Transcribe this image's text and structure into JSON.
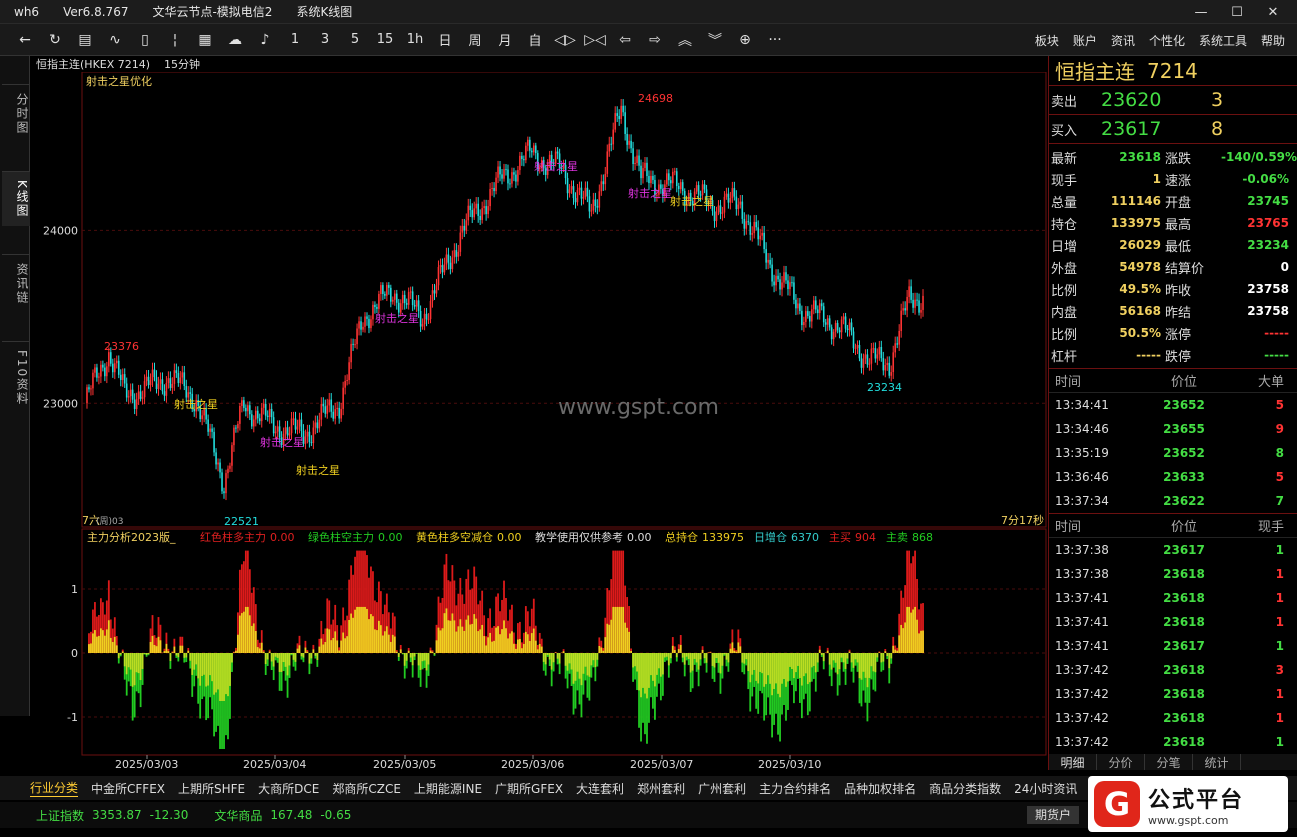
{
  "titlebar": {
    "app": "wh6",
    "version": "Ver6.8.767",
    "node": "文华云节点-模拟电信2",
    "window": "系统K线图",
    "min": "—",
    "max": "☐",
    "close": "✕"
  },
  "toolbar": {
    "period_buttons": [
      "1",
      "3",
      "5",
      "15",
      "1h",
      "日",
      "周",
      "月",
      "自"
    ],
    "right_menu": [
      "板块",
      "账户",
      "资讯",
      "个性化",
      "系统工具",
      "帮助"
    ]
  },
  "left_tabs": [
    "分时图",
    "K线图",
    "资讯链",
    "F10资料"
  ],
  "chart": {
    "instrument": "恒指主连(HKEX 7214)",
    "period": "15分钟",
    "indicator_name": "射击之星优化",
    "y_labels": [
      "24000",
      "23000"
    ],
    "high_label": "24698",
    "low_label1": "22521",
    "low_label2": "23234",
    "left_label": "23376",
    "pattern_label": "射击之星",
    "watermark": "www.gspt.com",
    "left_corner": "7六",
    "left_corner_sub": "(周)03",
    "countdown": "7分17秒",
    "sub_title": "主力分析2023版_",
    "sub_items": [
      {
        "label": "红色柱多主力",
        "value": "0.00",
        "color": "#e02020"
      },
      {
        "label": "绿色柱空主力",
        "value": "0.00",
        "color": "#22cc22"
      },
      {
        "label": "黄色柱多空减仓",
        "value": "0.00",
        "color": "#f0d020"
      },
      {
        "label": "教学使用仅供参考",
        "value": "0.00",
        "color": "#dddddd"
      },
      {
        "label": "总持仓",
        "value": "133975",
        "color": "#f0d020"
      },
      {
        "label": "日增仓",
        "value": "6370",
        "color": "#33cccc"
      },
      {
        "label": "主买",
        "value": "904",
        "color": "#e02020"
      },
      {
        "label": "主卖",
        "value": "868",
        "color": "#22cc22"
      }
    ],
    "sub_y_labels": [
      "1",
      "0",
      "-1"
    ],
    "dates": [
      "2025/03/03",
      "2025/03/04",
      "2025/03/05",
      "2025/03/06",
      "2025/03/07",
      "2025/03/10"
    ]
  },
  "quote": {
    "name": "恒指主连",
    "code": "7214",
    "sell_label": "卖出",
    "sell_price": "23620",
    "sell_vol": "3",
    "buy_label": "买入",
    "buy_price": "23617",
    "buy_vol": "8",
    "stats": [
      {
        "l1": "最新",
        "v1": "23618",
        "c1": "#44dd44",
        "l2": "涨跌",
        "v2": "-140/0.59%",
        "c2": "#44dd44"
      },
      {
        "l1": "现手",
        "v1": "1",
        "c1": "#f0d060",
        "l2": "速涨",
        "v2": "-0.06%",
        "c2": "#44dd44"
      },
      {
        "l1": "总量",
        "v1": "111146",
        "c1": "#f0d060",
        "l2": "开盘",
        "v2": "23745",
        "c2": "#44dd44"
      },
      {
        "l1": "持仓",
        "v1": "133975",
        "c1": "#f0d060",
        "l2": "最高",
        "v2": "23765",
        "c2": "#ff3333"
      },
      {
        "l1": "日增",
        "v1": "26029",
        "c1": "#f0d060",
        "l2": "最低",
        "v2": "23234",
        "c2": "#44dd44"
      },
      {
        "l1": "外盘",
        "v1": "54978",
        "c1": "#f0d060",
        "l2": "结算价",
        "v2": "0",
        "c2": "#ffffff"
      },
      {
        "l1": "比例",
        "v1": "49.5%",
        "c1": "#f0d060",
        "l2": "昨收",
        "v2": "23758",
        "c2": "#ffffff"
      },
      {
        "l1": "内盘",
        "v1": "56168",
        "c1": "#f0d060",
        "l2": "昨结",
        "v2": "23758",
        "c2": "#ffffff"
      },
      {
        "l1": "比例",
        "v1": "50.5%",
        "c1": "#f0d060",
        "l2": "涨停",
        "v2": "-----",
        "c2": "#ff3333"
      },
      {
        "l1": "杠杆",
        "v1": "-----",
        "c1": "#f0d060",
        "l2": "跌停",
        "v2": "-----",
        "c2": "#44dd44"
      }
    ],
    "big_head": [
      "时间",
      "价位",
      "大单"
    ],
    "big_orders": [
      {
        "t": "13:34:41",
        "p": "23652",
        "v": "5",
        "vc": "#ff3333"
      },
      {
        "t": "13:34:46",
        "p": "23655",
        "v": "9",
        "vc": "#ff3333"
      },
      {
        "t": "13:35:19",
        "p": "23652",
        "v": "8",
        "vc": "#44dd44"
      },
      {
        "t": "13:36:46",
        "p": "23633",
        "v": "5",
        "vc": "#ff3333"
      },
      {
        "t": "13:37:34",
        "p": "23622",
        "v": "7",
        "vc": "#44dd44"
      }
    ],
    "tick_head": [
      "时间",
      "价位",
      "现手"
    ],
    "ticks": [
      {
        "t": "13:37:38",
        "p": "23617",
        "v": "1",
        "vc": "#44dd44"
      },
      {
        "t": "13:37:38",
        "p": "23618",
        "v": "1",
        "vc": "#ff3333"
      },
      {
        "t": "13:37:41",
        "p": "23618",
        "v": "1",
        "vc": "#ff3333"
      },
      {
        "t": "13:37:41",
        "p": "23618",
        "v": "1",
        "vc": "#ff3333"
      },
      {
        "t": "13:37:41",
        "p": "23617",
        "v": "1",
        "vc": "#44dd44"
      },
      {
        "t": "13:37:42",
        "p": "23618",
        "v": "3",
        "vc": "#ff3333"
      },
      {
        "t": "13:37:42",
        "p": "23618",
        "v": "1",
        "vc": "#ff3333"
      },
      {
        "t": "13:37:42",
        "p": "23618",
        "v": "1",
        "vc": "#ff3333"
      },
      {
        "t": "13:37:42",
        "p": "23618",
        "v": "1",
        "vc": "#44dd44"
      }
    ],
    "sub_tabs": [
      "明细",
      "分价",
      "分笔",
      "统计"
    ]
  },
  "bottombar": [
    "行业分类",
    "中金所CFFEX",
    "上期所SHFE",
    "大商所DCE",
    "郑商所CZCE",
    "上期能源INE",
    "广期所GFEX",
    "大连套利",
    "郑州套利",
    "广州套利",
    "主力合约排名",
    "品种加权排名",
    "商品分类指数",
    "24小时资讯"
  ],
  "statusbar": {
    "idx1_name": "上证指数",
    "idx1_val": "3353.87",
    "idx1_chg": "-12.30",
    "idx2_name": "文华商品",
    "idx2_val": "167.48",
    "idx2_chg": "-0.65",
    "button": "期货户"
  },
  "logo": {
    "mark": "G",
    "name": "公式平台",
    "url": "www.gspt.com"
  },
  "colors": {
    "up": "#ff3333",
    "down": "#22dddd",
    "bg": "#000000",
    "grid": "#6b1010",
    "label_yellow": "#f0d060",
    "label_green": "#44dd44"
  }
}
